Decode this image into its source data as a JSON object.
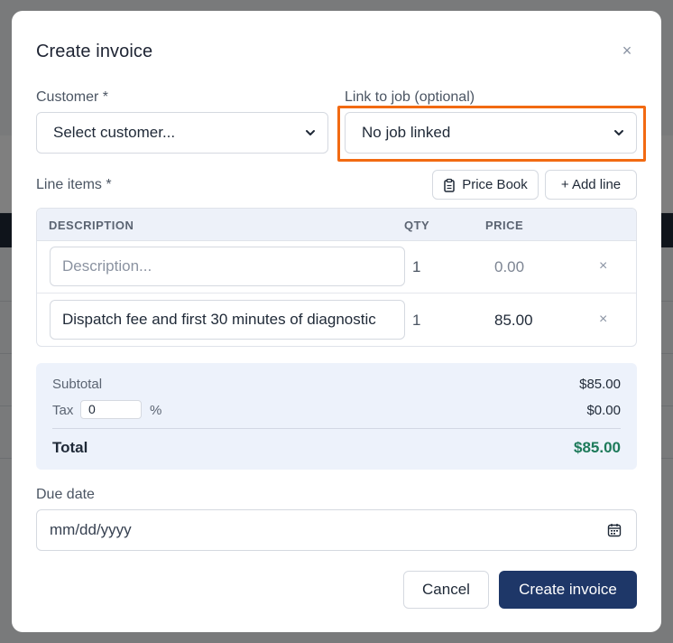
{
  "modal": {
    "title": "Create invoice",
    "close_glyph": "×"
  },
  "customer": {
    "label": "Customer *",
    "selected": "Select customer..."
  },
  "job_link": {
    "label": "Link to job (optional)",
    "selected": "No job linked"
  },
  "line_items": {
    "label": "Line items *",
    "price_book_label": "Price Book",
    "add_line_label": "+ Add line",
    "columns": [
      "DESCRIPTION",
      "QTY",
      "PRICE"
    ],
    "rows": [
      {
        "description": "",
        "description_placeholder": "Description...",
        "qty": "1",
        "price": "0.00",
        "remove": "×"
      },
      {
        "description": "Dispatch fee and first 30 minutes of diagnostic",
        "description_placeholder": "",
        "qty": "1",
        "price": "85.00",
        "remove": "×"
      }
    ]
  },
  "summary": {
    "subtotal_label": "Subtotal",
    "subtotal_value": "$85.00",
    "tax_label": "Tax",
    "tax_rate": "0",
    "tax_unit": "%",
    "tax_value": "$0.00",
    "total_label": "Total",
    "total_value": "$85.00"
  },
  "due_date": {
    "label": "Due date",
    "placeholder": "mm/dd/yyyy"
  },
  "actions": {
    "cancel_label": "Cancel",
    "submit_label": "Create invoice"
  },
  "icons": {
    "chevron": "chevron-down-icon",
    "clipboard": "clipboard-icon",
    "calendar": "calendar-icon",
    "close": "close-icon"
  },
  "colors": {
    "primary": "#1e3768",
    "total": "#1d7a5a",
    "highlight": "#f26a12",
    "summary_bg": "#edf2fb"
  }
}
